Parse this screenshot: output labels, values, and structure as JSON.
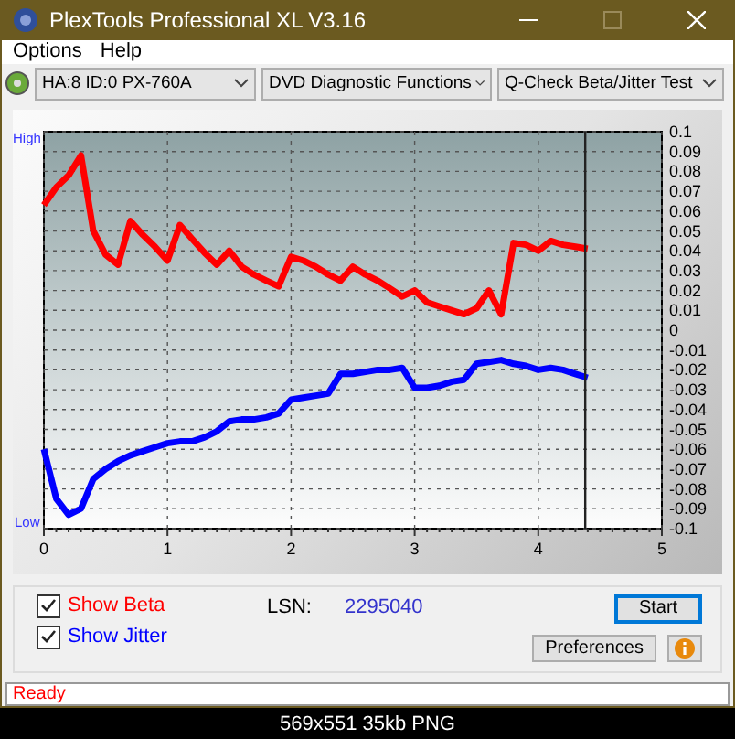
{
  "window": {
    "title": "PlexTools Professional XL V3.16"
  },
  "menu": [
    {
      "label": "Options"
    },
    {
      "label": "Help"
    }
  ],
  "toolbar": {
    "drive": "HA:8 ID:0  PX-760A",
    "function": "DVD Diagnostic Functions",
    "test": "Q-Check Beta/Jitter Test"
  },
  "chart": {
    "high_label": "High",
    "low_label": "Low",
    "chart_data": {
      "type": "line",
      "x": [
        0,
        0.1,
        0.2,
        0.3,
        0.4,
        0.5,
        0.6,
        0.7,
        0.8,
        0.9,
        1.0,
        1.1,
        1.2,
        1.3,
        1.4,
        1.5,
        1.6,
        1.7,
        1.8,
        1.9,
        2.0,
        2.1,
        2.2,
        2.3,
        2.4,
        2.5,
        2.6,
        2.7,
        2.8,
        2.9,
        3.0,
        3.1,
        3.2,
        3.3,
        3.4,
        3.5,
        3.6,
        3.7,
        3.8,
        3.9,
        4.0,
        4.1,
        4.2,
        4.3,
        4.4
      ],
      "series": [
        {
          "color": "#ff0000",
          "values": [
            0.063,
            0.072,
            0.078,
            0.088,
            0.05,
            0.038,
            0.033,
            0.055,
            0.048,
            0.042,
            0.035,
            0.053,
            0.046,
            0.039,
            0.033,
            0.04,
            0.032,
            0.028,
            0.025,
            0.022,
            0.037,
            0.035,
            0.032,
            0.028,
            0.025,
            0.032,
            0.028,
            0.025,
            0.021,
            0.017,
            0.02,
            0.014,
            0.012,
            0.01,
            0.008,
            0.011,
            0.02,
            0.008,
            0.044,
            0.043,
            0.04,
            0.045,
            0.043,
            0.042,
            0.041
          ]
        },
        {
          "color": "#0000ff",
          "values": [
            -0.06,
            -0.085,
            -0.093,
            -0.09,
            -0.075,
            -0.07,
            -0.066,
            -0.063,
            -0.061,
            -0.059,
            -0.057,
            -0.056,
            -0.056,
            -0.054,
            -0.051,
            -0.046,
            -0.045,
            -0.045,
            -0.044,
            -0.042,
            -0.035,
            -0.034,
            -0.033,
            -0.032,
            -0.022,
            -0.022,
            -0.021,
            -0.02,
            -0.02,
            -0.019,
            -0.029,
            -0.029,
            -0.028,
            -0.026,
            -0.025,
            -0.017,
            -0.016,
            -0.015,
            -0.017,
            -0.018,
            -0.02,
            -0.019,
            -0.02,
            -0.022,
            -0.024
          ]
        }
      ],
      "xlim": [
        0,
        5
      ],
      "ylim": [
        -0.1,
        0.1
      ],
      "xticks": [
        0,
        1,
        2,
        3,
        4,
        5
      ],
      "yticks": [
        {
          "value": 0.1,
          "label": "0.1"
        },
        {
          "value": 0.09,
          "label": "0.09"
        },
        {
          "value": 0.08,
          "label": "0.08"
        },
        {
          "value": 0.07,
          "label": "0.07"
        },
        {
          "value": 0.06,
          "label": "0.06"
        },
        {
          "value": 0.05,
          "label": "0.05"
        },
        {
          "value": 0.04,
          "label": "0.04"
        },
        {
          "value": 0.03,
          "label": "0.03"
        },
        {
          "value": 0.02,
          "label": "0.02"
        },
        {
          "value": 0.01,
          "label": "0.01"
        },
        {
          "value": 0,
          "label": "0"
        },
        {
          "value": -0.01,
          "label": "-0.01"
        },
        {
          "value": -0.02,
          "label": "-0.02"
        },
        {
          "value": -0.03,
          "label": "-0.03"
        },
        {
          "value": -0.04,
          "label": "-0.04"
        },
        {
          "value": -0.05,
          "label": "-0.05"
        },
        {
          "value": -0.06,
          "label": "-0.06"
        },
        {
          "value": -0.07,
          "label": "-0.07"
        },
        {
          "value": -0.08,
          "label": "-0.08"
        },
        {
          "value": -0.09,
          "label": "-0.09"
        },
        {
          "value": -0.1,
          "label": "-0.1"
        }
      ],
      "grid": true,
      "ref_lines": [
        {
          "axis": "x",
          "value": 4.38
        }
      ]
    }
  },
  "options": [
    {
      "label": "Show Beta",
      "checked": true,
      "color": "#ff0000"
    },
    {
      "label": "Show Jitter",
      "checked": true,
      "color": "#0000ff"
    }
  ],
  "lsn": {
    "label": "LSN:",
    "value": "2295040"
  },
  "buttons": [
    {
      "label": "Start",
      "kind": "default"
    },
    {
      "label": "Preferences",
      "kind": "normal"
    }
  ],
  "status_bar": "Ready",
  "image_caption": "569x551 35kb PNG"
}
